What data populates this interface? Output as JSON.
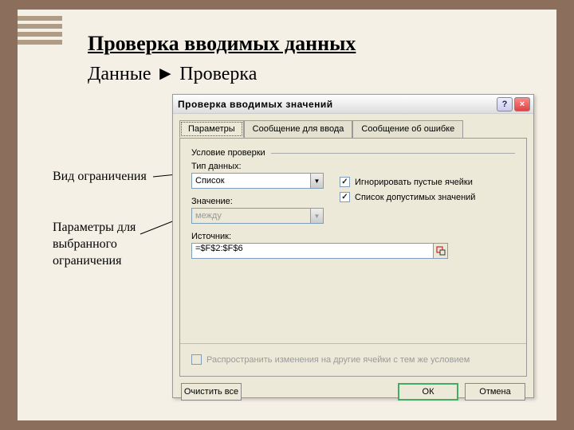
{
  "slide": {
    "heading": "Проверка вводимых данных",
    "subheading": "Данные ► Проверка",
    "annotations": {
      "a1": "Вид ограничения",
      "a2_line1": "Параметры для",
      "a2_line2": "выбранного",
      "a2_line3": "ограничения"
    }
  },
  "dialog": {
    "title": "Проверка вводимых значений",
    "help_symbol": "?",
    "close_symbol": "×",
    "tabs": {
      "params": "Параметры",
      "input_msg": "Сообщение для ввода",
      "error_msg": "Сообщение об ошибке"
    },
    "group": "Условие проверки",
    "fields": {
      "type_label": "Тип данных:",
      "type_value": "Список",
      "value_label": "Значение:",
      "value_value": "между",
      "source_label": "Источник:",
      "source_value": "=$F$2:$F$6"
    },
    "checkboxes": {
      "ignore_empty": "Игнорировать пустые ячейки",
      "allow_list": "Список допустимых значений"
    },
    "propagate": "Распространить изменения на другие ячейки с тем же условием",
    "buttons": {
      "clear": "Очистить все",
      "ok": "ОК",
      "cancel": "Отмена"
    },
    "check_mark": "✓",
    "dropdown_arrow": "▼"
  }
}
